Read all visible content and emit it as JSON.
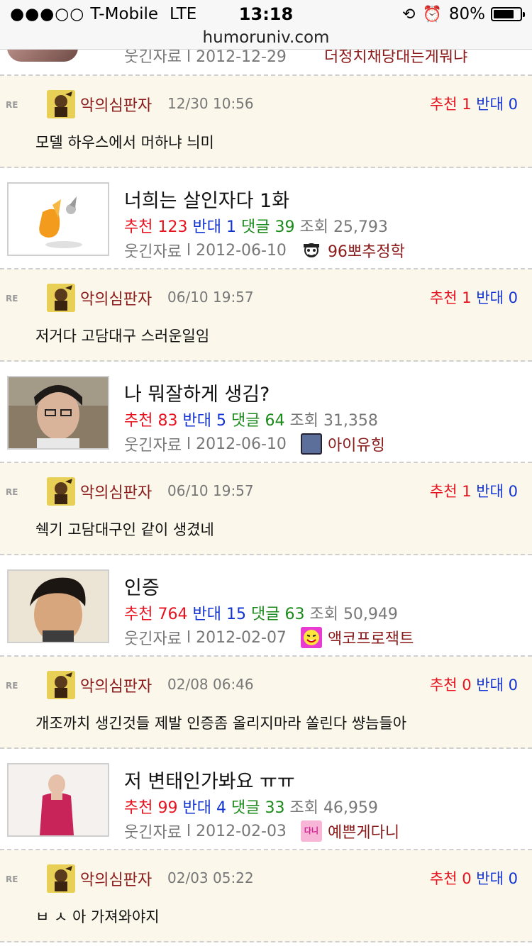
{
  "status": {
    "carrier": "T-Mobile",
    "network": "LTE",
    "time": "13:18",
    "battery": "80%",
    "battery_level": 0.8,
    "url": "humoruniv.com"
  },
  "top_partial": {
    "category": "웃긴자료",
    "date": "2012-12-29",
    "user": "더정치채당대는게뭐냐"
  },
  "items": [
    {
      "reply": {
        "re": "RE",
        "user": "악의심판자",
        "time": "12/30 10:56",
        "up_label": "추천",
        "up": "1",
        "down_label": "반대",
        "down": "0",
        "text": "모델 하우스에서 머하냐 늬미"
      }
    },
    {
      "post": {
        "title": "너희는 살인자다 1화",
        "up_label": "추천",
        "up": "123",
        "down_label": "반대",
        "down": "1",
        "cmt_label": "댓글",
        "cmt": "39",
        "view_label": "조회",
        "views": "25,793",
        "category": "웃긴자료",
        "date": "2012-06-10",
        "user": "96뽀추정학"
      },
      "reply": {
        "re": "RE",
        "user": "악의심판자",
        "time": "06/10 19:57",
        "up_label": "추천",
        "up": "1",
        "down_label": "반대",
        "down": "0",
        "text": "저거다 고담대구 스러운일임"
      }
    },
    {
      "post": {
        "title": "나 뭐잘하게 생김?",
        "up_label": "추천",
        "up": "83",
        "down_label": "반대",
        "down": "5",
        "cmt_label": "댓글",
        "cmt": "64",
        "view_label": "조회",
        "views": "31,358",
        "category": "웃긴자료",
        "date": "2012-06-10",
        "user": "아이유힝"
      },
      "reply": {
        "re": "RE",
        "user": "악의심판자",
        "time": "06/10 19:57",
        "up_label": "추천",
        "up": "1",
        "down_label": "반대",
        "down": "0",
        "text": "쉑기 고담대구인 같이 생겼네"
      }
    },
    {
      "post": {
        "title": "인증",
        "up_label": "추천",
        "up": "764",
        "down_label": "반대",
        "down": "15",
        "cmt_label": "댓글",
        "cmt": "63",
        "view_label": "조회",
        "views": "50,949",
        "category": "웃긴자료",
        "date": "2012-02-07",
        "user": "액코프로잭트"
      },
      "reply": {
        "re": "RE",
        "user": "악의심판자",
        "time": "02/08 06:46",
        "up_label": "추천",
        "up": "0",
        "down_label": "반대",
        "down": "0",
        "text": "개조까치 생긴것들 제발 인증좀 올리지마라 쏠린다 썅늠들아"
      }
    },
    {
      "post": {
        "title": "저 변태인가봐요 ㅠㅠ",
        "up_label": "추천",
        "up": "99",
        "down_label": "반대",
        "down": "4",
        "cmt_label": "댓글",
        "cmt": "33",
        "view_label": "조회",
        "views": "46,959",
        "category": "웃긴자료",
        "date": "2012-02-03",
        "user": "예쁜게다니",
        "avatar_text": "다니"
      },
      "reply": {
        "re": "RE",
        "user": "악의심판자",
        "time": "02/03 05:22",
        "up_label": "추천",
        "up": "0",
        "down_label": "반대",
        "down": "0",
        "text": "ㅂ ㅅ 아 가져와야지"
      }
    }
  ]
}
